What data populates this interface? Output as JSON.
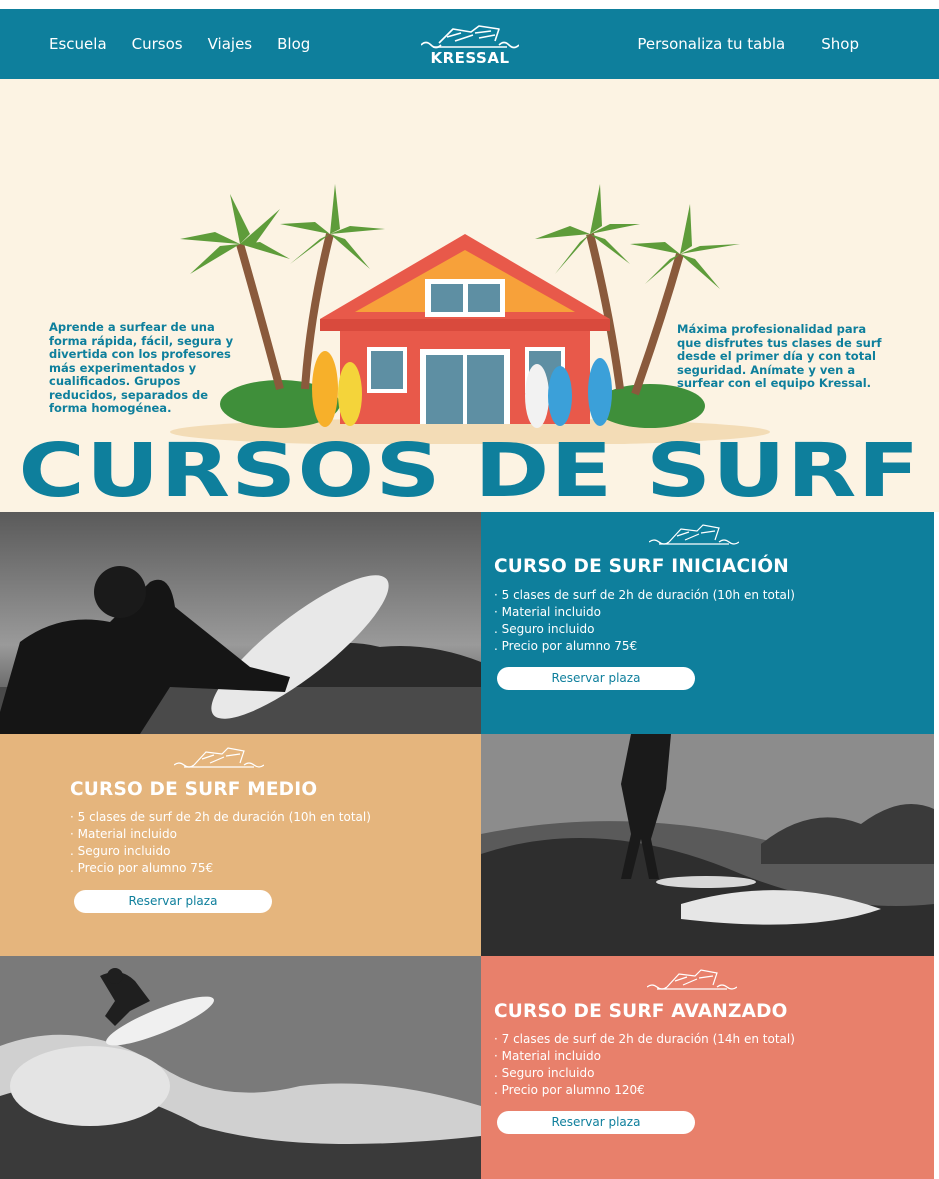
{
  "nav": {
    "left_items": [
      "Escuela",
      "Cursos",
      "Viajes",
      "Blog"
    ],
    "right_items": [
      "Personaliza tu tabla",
      "Shop"
    ],
    "logo_text": "KRESSAL"
  },
  "hero": {
    "left_text": "Aprende a surfear de una forma rápida, fácil, segura y divertida con los profesores más experimentados y cualificados. Grupos reducidos, separados de forma homogénea.",
    "right_text": " Máxima profesionalidad para que disfrutes tus clases de surf desde el primer día y con total seguridad. Anímate y ven a surfear con el equipo Kressal.",
    "title": "CURSOS DE SURF"
  },
  "courses": [
    {
      "title": "CURSO DE SURF INICIACIÓN",
      "items": [
        "· 5 clases de surf de 2h de duración (10h en total)",
        " · Material incluido",
        " . Seguro incluido",
        ". Precio por alumno 75€"
      ],
      "button": "Reservar plaza"
    },
    {
      "title": "CURSO DE SURF MEDIO",
      "items": [
        "· 5 clases de surf de 2h de duración (10h en total)",
        "· Material incluido",
        ". Seguro incluido",
        ". Precio por alumno 75€"
      ],
      "button": "Reservar plaza"
    },
    {
      "title": "CURSO DE SURF AVANZADO",
      "items": [
        "· 7 clases de surf de 2h de duración (14h en total)",
        "· Material incluido",
        ". Seguro incluido",
        ". Precio por alumno 120€"
      ],
      "button": "Reservar plaza"
    }
  ],
  "colors": {
    "brand_blue": "#0e7f9c",
    "hero_bg": "#fcf3e3",
    "medio_bg": "#e5b57d",
    "avanzado_bg": "#e8806b"
  }
}
